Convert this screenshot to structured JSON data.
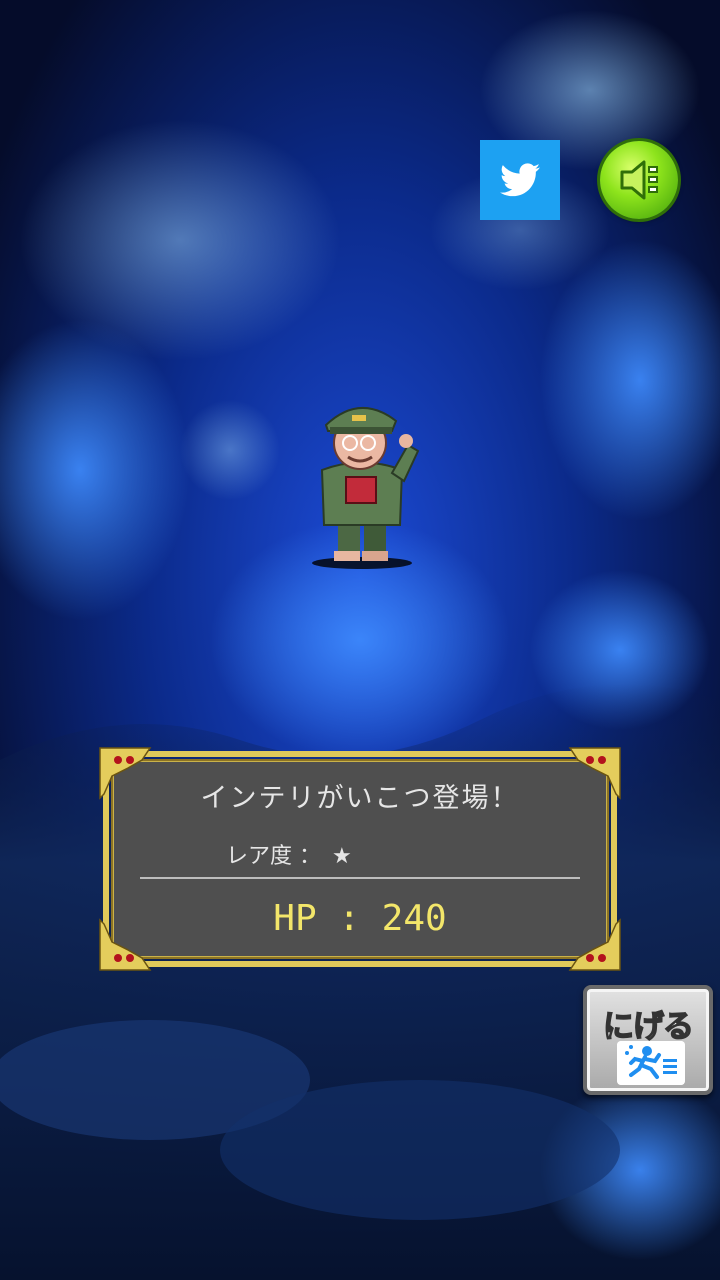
{
  "encounter": {
    "message": "インテリがいこつ登場！",
    "rarity_label": "レア度 ：",
    "rarity_stars": "★",
    "hp_text": "HP : 240"
  },
  "buttons": {
    "run_label": "にげる"
  },
  "icons": {
    "share": "twitter-icon",
    "sound": "speaker-icon",
    "run": "running-man-icon"
  },
  "colors": {
    "twitter": "#1da1f2",
    "sound": "#8ee41c",
    "hp_text": "#f3e66a",
    "panel": "#4f4f4f",
    "frame_gold": "#c9b24a"
  }
}
